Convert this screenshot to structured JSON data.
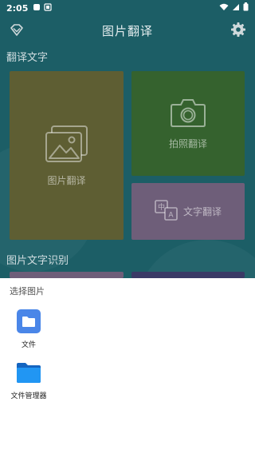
{
  "status_bar": {
    "time": "2:05"
  },
  "app_bar": {
    "title": "图片翻译"
  },
  "sections": {
    "translate_title": "翻译文字",
    "ocr_title": "图片文字识别"
  },
  "tiles": {
    "photo_label": "图片翻译",
    "camera_label": "拍照翻译",
    "text_label": "文字翻译",
    "text_icon_glyph_left": "中",
    "text_icon_glyph_right": "A"
  },
  "sheet": {
    "title": "选择图片",
    "apps": [
      {
        "label": "文件",
        "icon": "files-app-icon"
      },
      {
        "label": "文件管理器",
        "icon": "file-manager-icon"
      }
    ]
  },
  "colors": {
    "app_background": "#1c5e66",
    "tile_photo": "#5e5e33",
    "tile_camera": "#35622e",
    "tile_text": "#6e5e79",
    "files_icon": "#4a86e8",
    "file_manager_icon": "#1e88e5"
  }
}
